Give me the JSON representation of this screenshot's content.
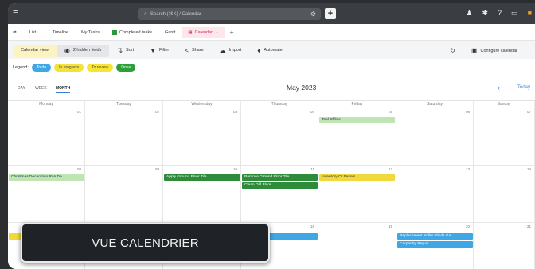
{
  "header": {
    "search_placeholder": "Search (⌘K) / Calendar",
    "icons": [
      "menu-icon",
      "search-icon",
      "gear-icon",
      "plus-icon",
      "users-icon",
      "settings-icon",
      "help-icon",
      "inbox-icon",
      "notification-icon"
    ]
  },
  "tabs": [
    {
      "label": "List",
      "icon": "filter-icon"
    },
    {
      "label": "Timeline"
    },
    {
      "label": "My Tasks"
    },
    {
      "label": "Completed tasks"
    },
    {
      "label": "Gantt"
    },
    {
      "label": "Calendar",
      "active": true
    }
  ],
  "toolbar": {
    "calendar_view": "Calendar view",
    "hidden_fields": "2 hidden fields",
    "sort": "Sort",
    "filter": "Filter",
    "share": "Share",
    "import": "Import",
    "automate": "Automate",
    "configure": "Configure calendar"
  },
  "legend": {
    "label": "Legend:",
    "items": [
      {
        "label": "To do",
        "color": "#3fa7e6"
      },
      {
        "label": "In progress",
        "color": "#f3e23c"
      },
      {
        "label": "To review",
        "color": "#f6e535"
      },
      {
        "label": "Done",
        "color": "#2e9d3c"
      }
    ]
  },
  "view": {
    "day": "DAY",
    "week": "WEEK",
    "month": "MONTH",
    "title": "May 2023",
    "today": "Today"
  },
  "days": [
    "Monday",
    "Tuesday",
    "Wednesday",
    "Thursday",
    "Friday",
    "Saturday",
    "Sunday"
  ],
  "weeks": [
    [
      "01",
      "02",
      "03",
      "04",
      "05",
      "06",
      "07"
    ],
    [
      "08",
      "09",
      "10",
      "11",
      "12",
      "13",
      "14"
    ],
    [
      "15",
      "16",
      "17",
      "18",
      "19",
      "20",
      "21"
    ]
  ],
  "events": {
    "tool_offline": "Tool Offline",
    "christmas": "Christmas Decoration Run Do...",
    "apply_ground": "Apply Ground Floor Tile",
    "remove_ground": "Remove Ground Floor Tile",
    "clean_old_floor": "Clean Old Floor",
    "inventory": "Inventory Of Panels",
    "week3_thu": "Tile Floor",
    "replacement": "Replacement Roller Blinds Ga...",
    "carpentry": "Carpentry Repair"
  },
  "caption": "VUE CALENDRIER"
}
